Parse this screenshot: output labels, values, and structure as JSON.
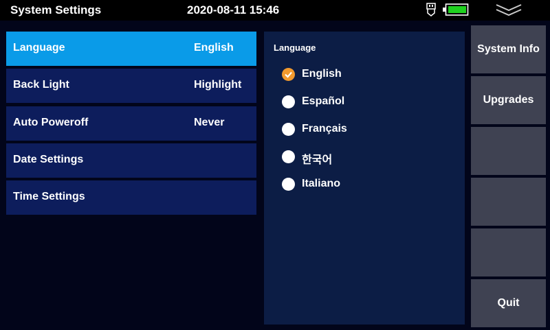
{
  "header": {
    "title": "System Settings",
    "datetime": "2020-08-11 15:46",
    "icons": [
      "usb-icon",
      "battery-icon",
      "collapse-chevron-icon"
    ],
    "battery_color": "#1fd11f"
  },
  "menu": {
    "items": [
      {
        "label": "Language",
        "value": "English",
        "active": true
      },
      {
        "label": "Back Light",
        "value": "Highlight"
      },
      {
        "label": "Auto Poweroff",
        "value": "Never"
      },
      {
        "label": "Date Settings",
        "value": ""
      },
      {
        "label": "Time Settings",
        "value": ""
      }
    ]
  },
  "language_panel": {
    "title": "Language",
    "options": [
      {
        "label": "English",
        "selected": true
      },
      {
        "label": "Español",
        "selected": false
      },
      {
        "label": "Français",
        "selected": false
      },
      {
        "label": "한국어",
        "selected": false
      },
      {
        "label": "Italiano",
        "selected": false
      }
    ]
  },
  "side_buttons": {
    "system_info": "System Info",
    "upgrades": "Upgrades",
    "quit": "Quit"
  },
  "colors": {
    "active_row": "#0a9be8",
    "row": "#0d1d5c",
    "panel": "#0c1d45",
    "side_button": "#3f4252",
    "radio_selected": "#f29a2e"
  }
}
